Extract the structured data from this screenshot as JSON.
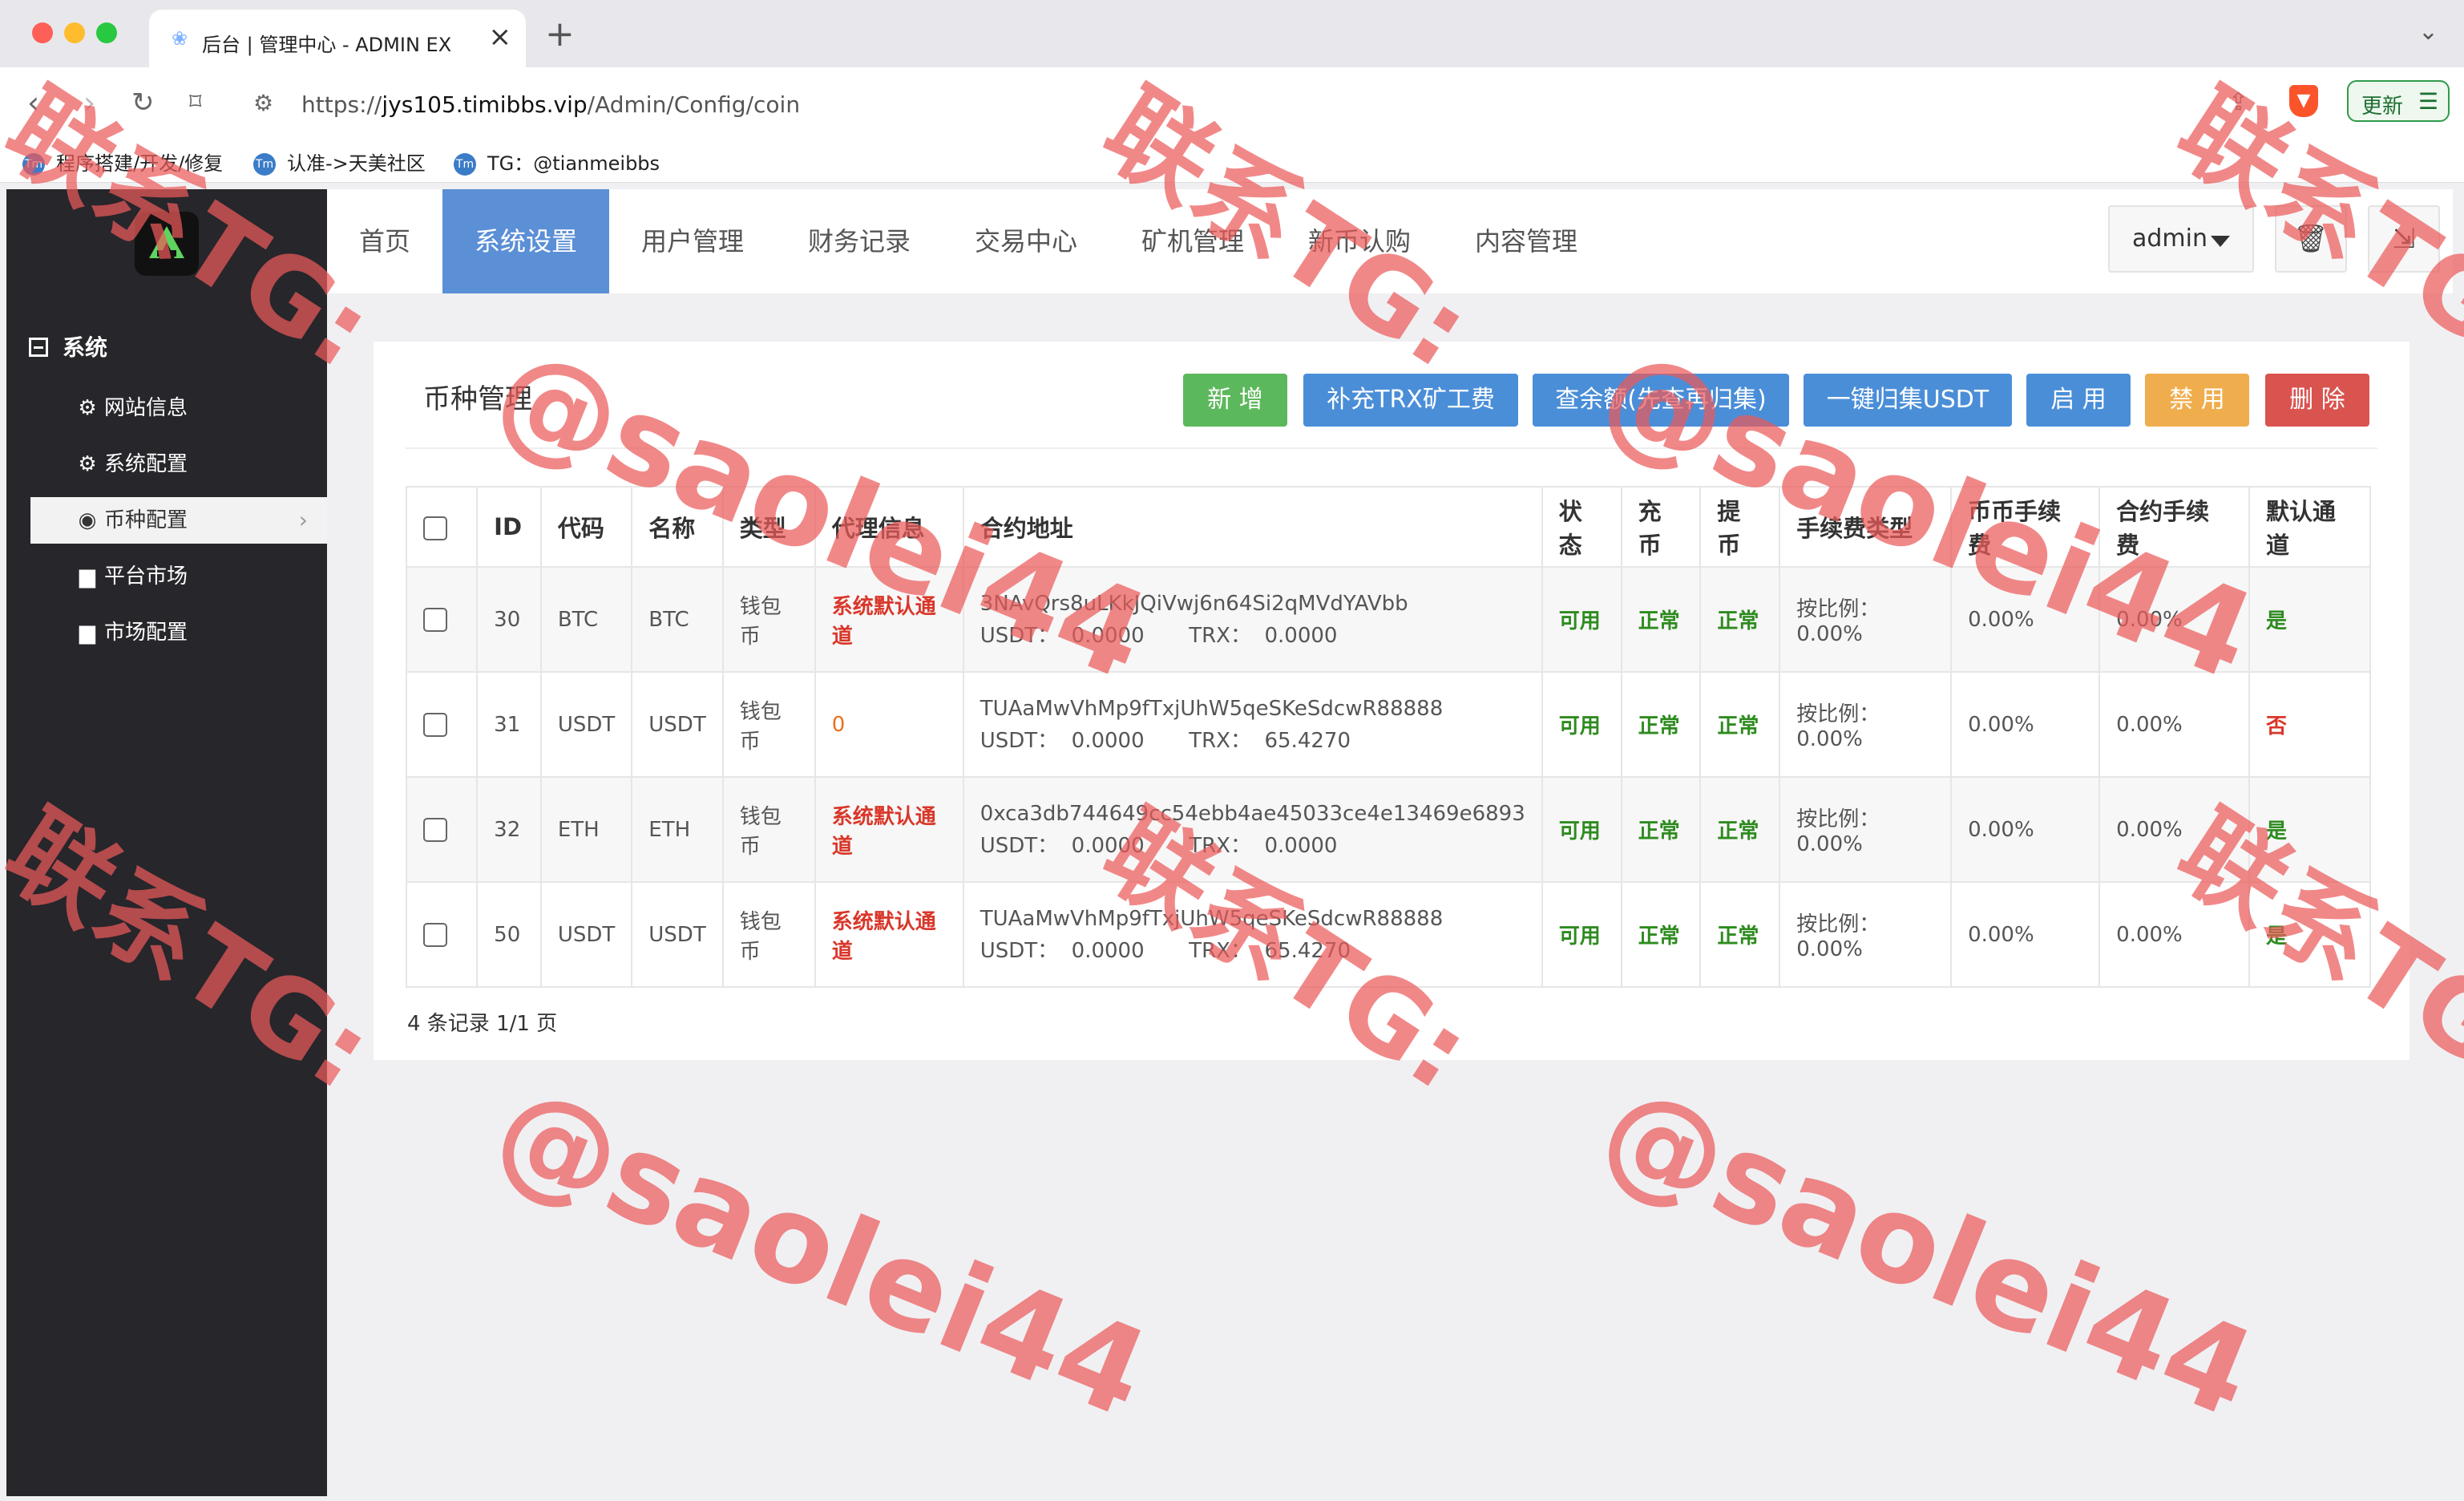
{
  "browser": {
    "tab_title": "后台 | 管理中心 - ADMIN EX",
    "url_prefix": "https://",
    "url_host": "jys105.timibbs.vip",
    "url_path": "/Admin/Config/coin",
    "update_label": "更新",
    "bookmarks": [
      "程序搭建/开发/修复",
      "认准->天美社区",
      "TG：@tianmeibbs"
    ]
  },
  "sidebar": {
    "section": "系统",
    "items": [
      {
        "label": "网站信息",
        "icon": "gear-icon"
      },
      {
        "label": "系统配置",
        "icon": "gear-icon"
      },
      {
        "label": "币种配置",
        "icon": "target-icon"
      },
      {
        "label": "平台市场",
        "icon": "bar-chart-icon"
      },
      {
        "label": "市场配置",
        "icon": "bar-chart-icon"
      }
    ]
  },
  "topnav": {
    "items": [
      "首页",
      "系统设置",
      "用户管理",
      "财务记录",
      "交易中心",
      "矿机管理",
      "新币认购",
      "内容管理"
    ],
    "active": "系统设置",
    "user": "admin"
  },
  "panel": {
    "title": "币种管理",
    "buttons": {
      "add": "新 增",
      "topup_trx": "补充TRX矿工费",
      "check_balance": "查余额(先查再归集)",
      "collect_usdt": "一键归集USDT",
      "enable": "启 用",
      "disable": "禁 用",
      "delete": "删 除"
    },
    "columns": [
      "ID",
      "代码",
      "名称",
      "类型",
      "代理信息",
      "合约地址",
      "状态",
      "充币",
      "提币",
      "手续费类型",
      "币币手续费",
      "合约手续费",
      "默认通道"
    ],
    "rows": [
      {
        "id": "30",
        "code": "BTC",
        "name": "BTC",
        "type": "钱包币",
        "agent": "系统默认通道",
        "address": "3NAvQrs8uLKkJQiVwj6n64Si2qMVdYAVbb",
        "usdt_label": "USDT：",
        "usdt": "0.0000",
        "trx_label": "TRX：",
        "trx": "0.0000",
        "status": "可用",
        "deposit": "正常",
        "withdraw": "正常",
        "fee_type": "按比例：0.00%",
        "spot_fee": "0.00%",
        "contract_fee": "0.00%",
        "default": "是"
      },
      {
        "id": "31",
        "code": "USDT",
        "name": "USDT",
        "type": "钱包币",
        "agent": "0",
        "address": "TUAaMwVhMp9fTxjUhW5qeSKeSdcwR88888",
        "usdt_label": "USDT：",
        "usdt": "0.0000",
        "trx_label": "TRX：",
        "trx": "65.4270",
        "status": "可用",
        "deposit": "正常",
        "withdraw": "正常",
        "fee_type": "按比例：0.00%",
        "spot_fee": "0.00%",
        "contract_fee": "0.00%",
        "default": "否"
      },
      {
        "id": "32",
        "code": "ETH",
        "name": "ETH",
        "type": "钱包币",
        "agent": "系统默认通道",
        "address": "0xca3db744649cc54ebb4ae45033ce4e13469e6893",
        "usdt_label": "USDT：",
        "usdt": "0.0000",
        "trx_label": "TRX：",
        "trx": "0.0000",
        "status": "可用",
        "deposit": "正常",
        "withdraw": "正常",
        "fee_type": "按比例：0.00%",
        "spot_fee": "0.00%",
        "contract_fee": "0.00%",
        "default": "是"
      },
      {
        "id": "50",
        "code": "USDT",
        "name": "USDT",
        "type": "钱包币",
        "agent": "系统默认通道",
        "address": "TUAaMwVhMp9fTxjUhW5qeSKeSdcwR88888",
        "usdt_label": "USDT：",
        "usdt": "0.0000",
        "trx_label": "TRX：",
        "trx": "65.4270",
        "status": "可用",
        "deposit": "正常",
        "withdraw": "正常",
        "fee_type": "按比例：0.00%",
        "spot_fee": "0.00%",
        "contract_fee": "0.00%",
        "default": "是"
      }
    ],
    "footer": "4 条记录 1/1 页"
  },
  "watermark": {
    "contact": "联系TG:",
    "handle": "@saolei44",
    "color": "#ec5a5a"
  }
}
